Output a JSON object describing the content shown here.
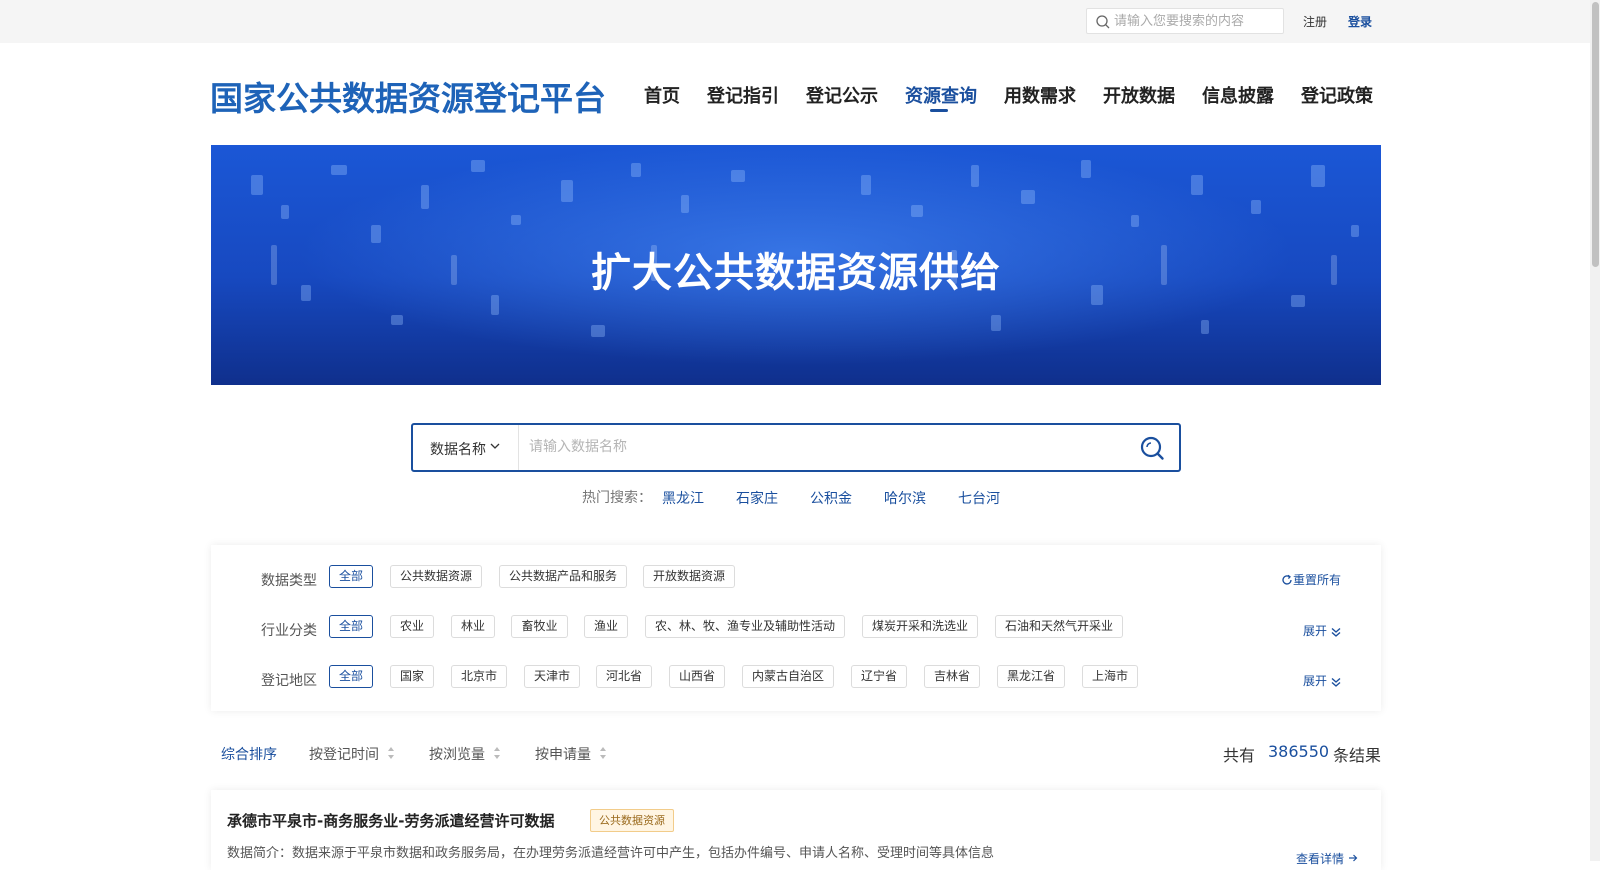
{
  "top_bar": {
    "search_placeholder": "请输入您要搜索的内容",
    "register": "注册",
    "login": "登录"
  },
  "header": {
    "site_title": "国家公共数据资源登记平台",
    "nav": [
      {
        "label": "首页",
        "active": false
      },
      {
        "label": "登记指引",
        "active": false
      },
      {
        "label": "登记公示",
        "active": false
      },
      {
        "label": "资源查询",
        "active": true
      },
      {
        "label": "用数需求",
        "active": false
      },
      {
        "label": "开放数据",
        "active": false
      },
      {
        "label": "信息披露",
        "active": false
      },
      {
        "label": "登记政策",
        "active": false
      }
    ]
  },
  "banner": {
    "title": "扩大公共数据资源供给"
  },
  "search": {
    "type_label": "数据名称",
    "placeholder": "请输入数据名称",
    "hot_label": "热门搜索：",
    "hot_terms": [
      "黑龙江",
      "石家庄",
      "公积金",
      "哈尔滨",
      "七台河"
    ]
  },
  "filters": {
    "data_type": {
      "label": "数据类型",
      "options": [
        "全部",
        "公共数据资源",
        "公共数据产品和服务",
        "开放数据资源"
      ],
      "selected": "全部",
      "action": "重置所有"
    },
    "industry": {
      "label": "行业分类",
      "options": [
        "全部",
        "农业",
        "林业",
        "畜牧业",
        "渔业",
        "农、林、牧、渔专业及辅助性活动",
        "煤炭开采和洗选业",
        "石油和天然气开采业"
      ],
      "selected": "全部",
      "action": "展开"
    },
    "region": {
      "label": "登记地区",
      "options": [
        "全部",
        "国家",
        "北京市",
        "天津市",
        "河北省",
        "山西省",
        "内蒙古自治区",
        "辽宁省",
        "吉林省",
        "黑龙江省",
        "上海市"
      ],
      "selected": "全部",
      "action": "展开"
    }
  },
  "sort": {
    "options": [
      "综合排序",
      "按登记时间",
      "按浏览量",
      "按申请量"
    ],
    "active": "综合排序"
  },
  "results": {
    "total_prefix": "共有",
    "total": "386550",
    "total_suffix": "条结果",
    "items": [
      {
        "title": "承德市平泉市-商务服务业-劳务派遣经营许可数据",
        "badge": "公共数据资源",
        "description": "数据简介：数据来源于平泉市数据和政务服务局，在办理劳务派遣经营许可中产生，包括办件编号、申请人名称、受理时间等具体信息",
        "detail_link": "查看详情"
      }
    ]
  },
  "colors": {
    "primary": "#1a4f9e",
    "title_blue": "#1e63b8",
    "banner_blue": "#1b57d6",
    "badge_bg": "#fff5e3"
  }
}
